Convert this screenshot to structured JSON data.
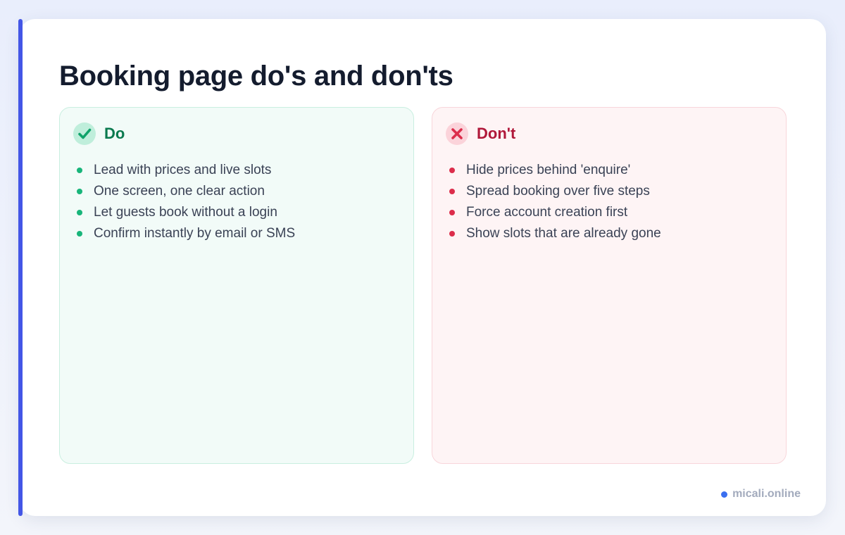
{
  "page": {
    "title": "Booking page do's and don'ts"
  },
  "do_panel": {
    "label": "Do",
    "icon": "check-icon",
    "items": [
      "Lead with prices and live slots",
      "One screen, one clear action",
      "Let guests book without a login",
      "Confirm instantly by email or SMS"
    ]
  },
  "dont_panel": {
    "label": "Don't",
    "icon": "cross-icon",
    "items": [
      "Hide prices behind 'enquire'",
      "Spread booking over five steps",
      "Force account creation first",
      "Show slots that are already gone"
    ]
  },
  "footer": {
    "brand": "micali.online"
  },
  "colors": {
    "accent": "#4356e6",
    "do": "#0b7a4f",
    "dont": "#b0183a",
    "brand_dot": "#3b6ff0"
  }
}
